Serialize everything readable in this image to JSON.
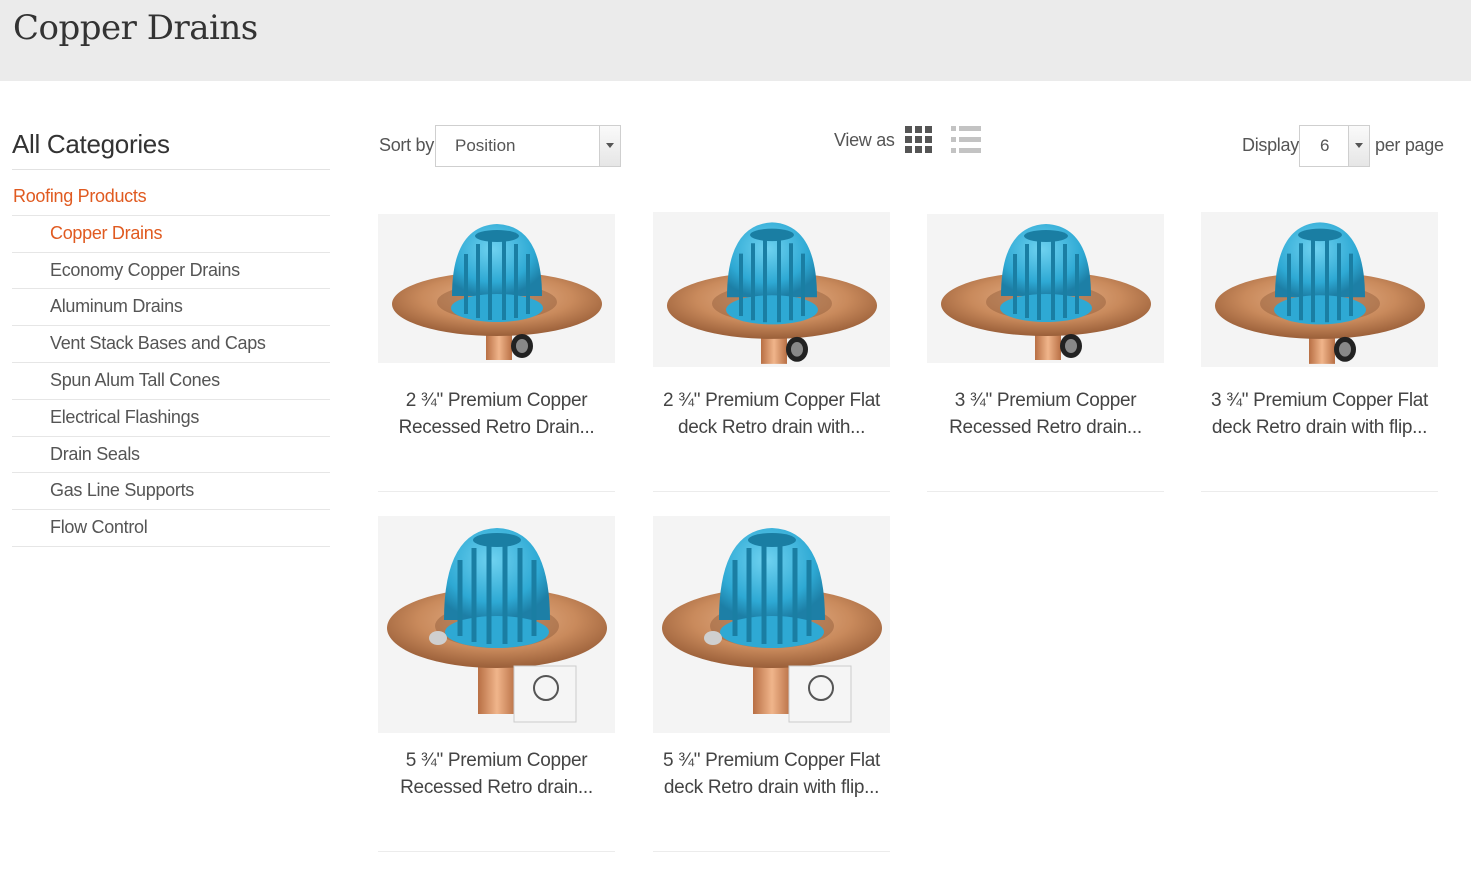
{
  "page": {
    "title": "Copper Drains"
  },
  "sidebar": {
    "heading": "All Categories",
    "items": [
      {
        "label": "Roofing Products",
        "level": "top",
        "active": true
      },
      {
        "label": "Copper Drains",
        "level": "sub",
        "active": true
      },
      {
        "label": "Economy Copper Drains",
        "level": "sub",
        "active": false
      },
      {
        "label": "Aluminum Drains",
        "level": "sub",
        "active": false
      },
      {
        "label": "Vent Stack Bases and Caps",
        "level": "sub",
        "active": false
      },
      {
        "label": "Spun Alum Tall Cones",
        "level": "sub",
        "active": false
      },
      {
        "label": "Electrical Flashings",
        "level": "sub",
        "active": false
      },
      {
        "label": "Drain Seals",
        "level": "sub",
        "active": false
      },
      {
        "label": "Gas Line Supports",
        "level": "sub",
        "active": false
      },
      {
        "label": "Flow Control",
        "level": "sub",
        "active": false
      }
    ]
  },
  "toolbar": {
    "sort_label": "Sort by",
    "sort_value": "Position",
    "view_label": "View as",
    "view_modes": [
      {
        "icon": "grid-icon",
        "active": true
      },
      {
        "icon": "list-icon",
        "active": false
      }
    ],
    "display_label": "Display",
    "display_value": "6",
    "per_page_label": "per page"
  },
  "products": [
    {
      "name_line1": "2 ¾\" Premium Copper",
      "name_line2": "Recessed Retro Drain..."
    },
    {
      "name_line1": "2 ¾\" Premium Copper Flat",
      "name_line2": "deck Retro drain with..."
    },
    {
      "name_line1": "3 ¾\" Premium Copper",
      "name_line2": "Recessed Retro drain..."
    },
    {
      "name_line1": "3 ¾\" Premium Copper Flat",
      "name_line2": "deck Retro drain with flip..."
    },
    {
      "name_line1": "5 ¾\" Premium Copper",
      "name_line2": "Recessed Retro drain..."
    },
    {
      "name_line1": "5 ¾\" Premium Copper Flat",
      "name_line2": "deck Retro drain with flip..."
    }
  ],
  "colors": {
    "accent": "#e05a20",
    "title_bar": "#ebebeb",
    "strainer_blue": "#2ea9d4",
    "copper": "#c98a5c"
  }
}
